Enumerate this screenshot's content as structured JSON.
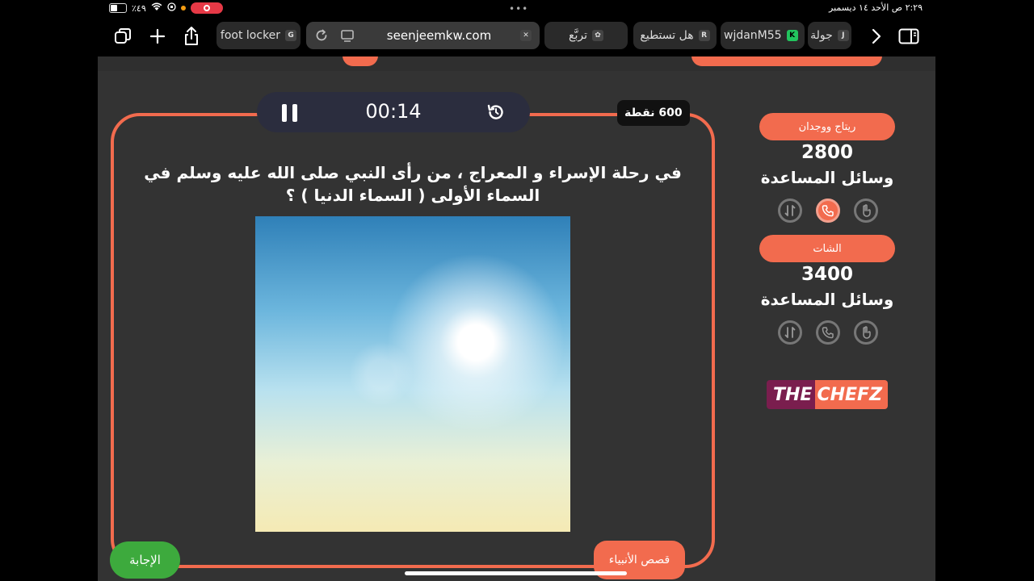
{
  "status_bar": {
    "battery": "٪٤٩",
    "battery_level": 0.49,
    "datetime": "٢:٢٩ ص   الأحد ١٤ ديسمبر"
  },
  "browser": {
    "tabs": [
      {
        "label": "foot locker",
        "favicon": "G"
      },
      {
        "label": "seenjeemkw.com",
        "favicon": "site-icon",
        "active": true
      },
      {
        "label": "تربَّع",
        "favicon": "app-icon"
      },
      {
        "label": "هل تستطيع",
        "favicon": "R"
      },
      {
        "label": "wjdanM55",
        "favicon": "K"
      },
      {
        "label": "جولة",
        "favicon": "J"
      }
    ]
  },
  "game": {
    "timer": "00:14",
    "points": "600 نقطة",
    "question": "في رحلة الإسراء و المعراج ، من رأى النبي صلى الله عليه وسلم في السماء الأولى ( السماء الدنيا ) ؟",
    "category": "قصص الأنبياء",
    "answer_button": "الإجابة",
    "teams": [
      {
        "name": "ريتاج ووجدان",
        "score": "2800",
        "aids_label": "وسائل المساعدة",
        "active_aid": "call"
      },
      {
        "name": "الشات",
        "score": "3400",
        "aids_label": "وسائل المساعدة",
        "active_aid": ""
      }
    ],
    "logo": {
      "part1": "THE",
      "part2": "CHEFZ"
    }
  },
  "colors": {
    "accent": "#f26b4e",
    "background": "#333333",
    "answer": "#3daa3d",
    "timer_bg": "#2b2d3e"
  }
}
